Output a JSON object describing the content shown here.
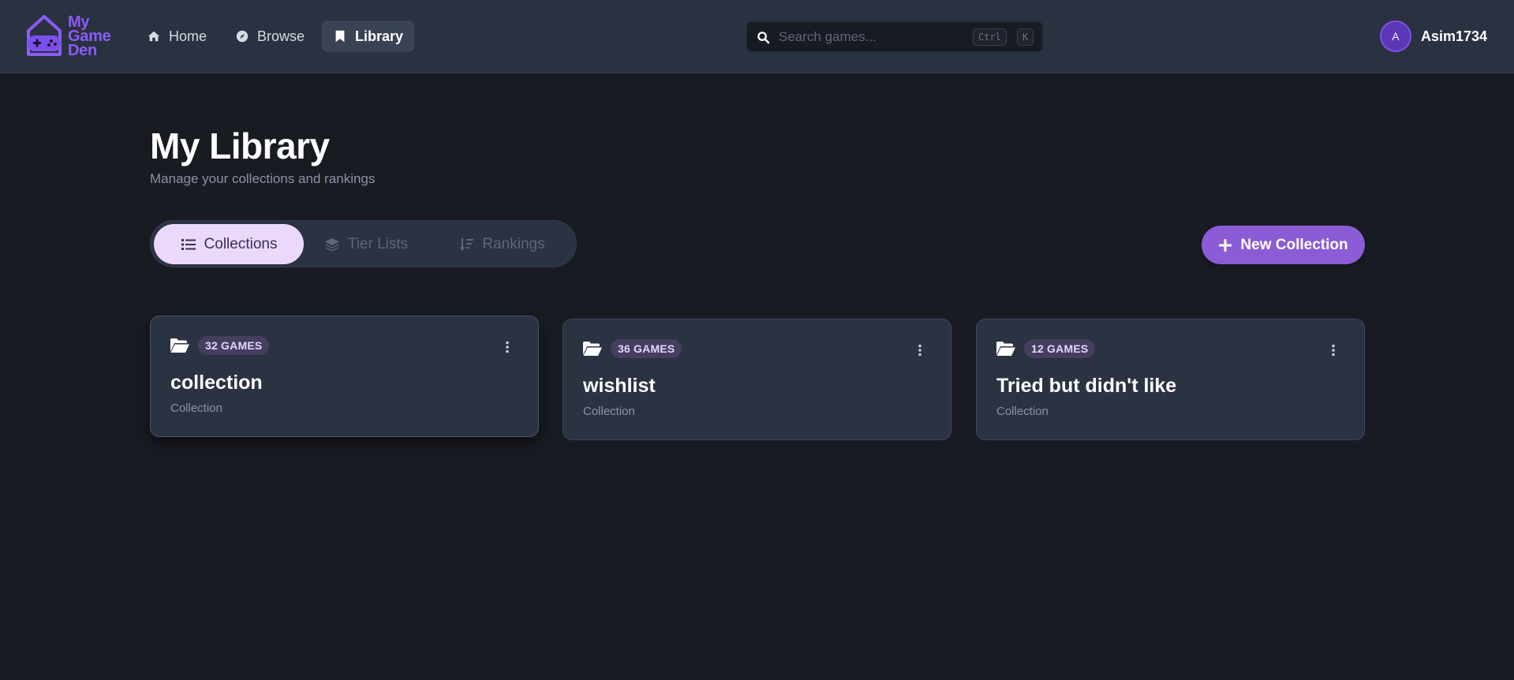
{
  "brand": {
    "line1": "My",
    "line2": "Game",
    "line3": "Den",
    "color": "#8b5cf6"
  },
  "nav": {
    "items": [
      {
        "label": "Home",
        "icon": "home-icon"
      },
      {
        "label": "Browse",
        "icon": "compass-icon"
      },
      {
        "label": "Library",
        "icon": "bookmark-icon",
        "active": true
      }
    ]
  },
  "search": {
    "placeholder": "Search games...",
    "shortcut_ctrl": "Ctrl",
    "shortcut_key": "K"
  },
  "user": {
    "initial": "A",
    "name": "Asim1734"
  },
  "page": {
    "title": "My Library",
    "subtitle": "Manage your collections and rankings"
  },
  "tabs": [
    {
      "label": "Collections",
      "icon": "list-icon",
      "active": true
    },
    {
      "label": "Tier Lists",
      "icon": "layers-icon"
    },
    {
      "label": "Rankings",
      "icon": "sort-icon"
    }
  ],
  "new_collection_label": "New Collection",
  "collections": [
    {
      "count": "32 GAMES",
      "name": "collection",
      "type": "Collection"
    },
    {
      "count": "36 GAMES",
      "name": "wishlist",
      "type": "Collection"
    },
    {
      "count": "12 GAMES",
      "name": "Tried but didn't like",
      "type": "Collection"
    }
  ],
  "colors": {
    "accent": "#8b5cd6",
    "background": "#191b23",
    "card": "#2b3242",
    "active_tab": "#ead9fc"
  }
}
